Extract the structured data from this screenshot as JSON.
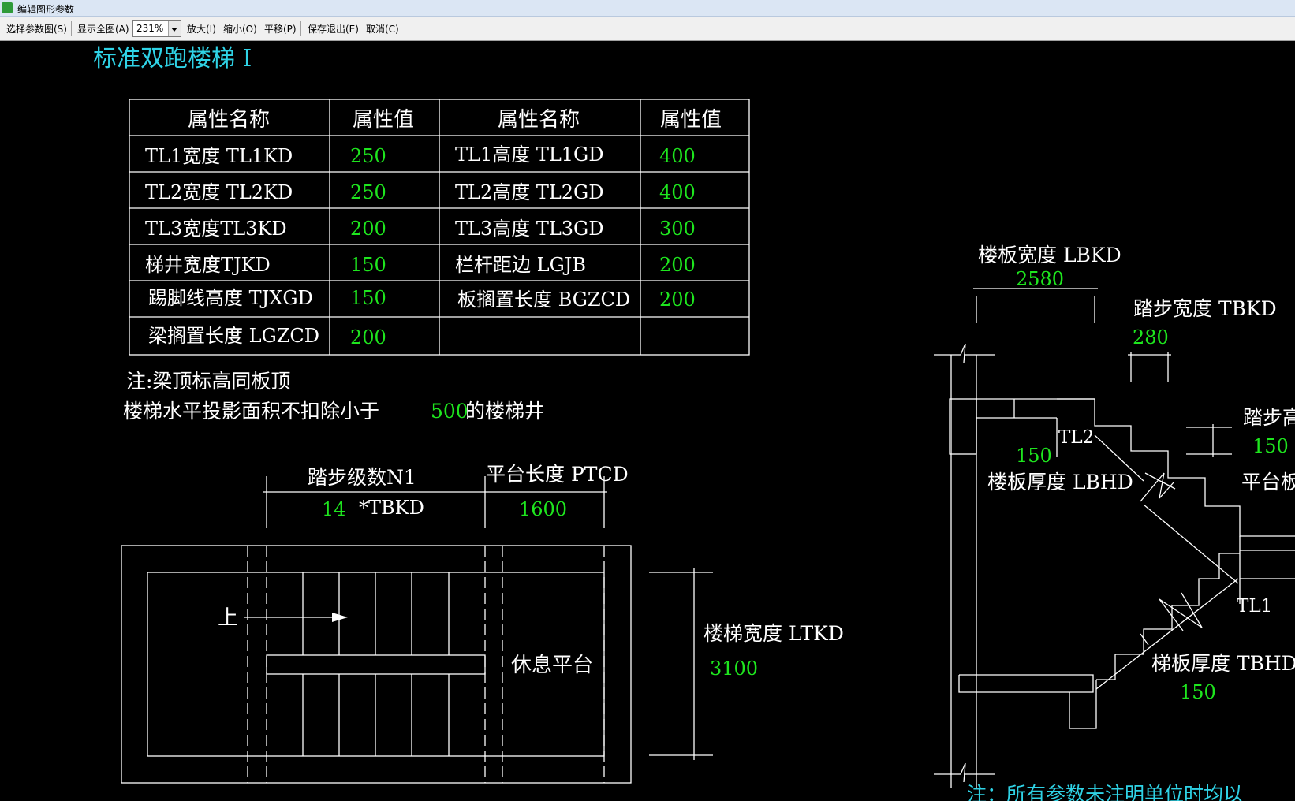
{
  "window": {
    "title": "编辑图形参数"
  },
  "toolbar": {
    "select_params": "选择参数图(S)",
    "show_all": "显示全图(A)",
    "zoom_value": "231%",
    "zoom_in": "放大(I)",
    "zoom_out": "缩小(O)",
    "pan": "平移(P)",
    "save_exit": "保存退出(E)",
    "cancel": "取消(C)"
  },
  "drawing": {
    "title": "标准双跑楼梯 I",
    "table": {
      "headers": [
        "属性名称",
        "属性值",
        "属性名称",
        "属性值"
      ],
      "rows": [
        [
          "TL1宽度 TL1KD",
          "250",
          "TL1高度 TL1GD",
          "400"
        ],
        [
          "TL2宽度 TL2KD",
          "250",
          "TL2高度 TL2GD",
          "400"
        ],
        [
          "TL3宽度TL3KD",
          "200",
          "TL3高度 TL3GD",
          "300"
        ],
        [
          "梯井宽度TJKD",
          "150",
          "栏杆距边 LGJB",
          "200"
        ],
        [
          "踢脚线高度 TJXGD",
          "150",
          "板搁置长度 BGZCD",
          "200"
        ],
        [
          "梁搁置长度 LGZCD",
          "200",
          "",
          ""
        ]
      ]
    },
    "note1": "注:梁顶标高同板顶",
    "note2_prefix": "楼梯水平投影面积不扣除小于",
    "note2_value": "500",
    "note2_suffix": "的楼梯井",
    "plan": {
      "steps_label": "踏步级数N1",
      "steps_value": "14",
      "steps_unit": "*TBKD",
      "platform_len_label": "平台长度 PTCD",
      "platform_len_value": "1600",
      "up_label": "上",
      "rest_platform": "休息平台",
      "stair_width_label": "楼梯宽度 LTKD",
      "stair_width_value": "3100"
    },
    "section": {
      "slab_width_label": "楼板宽度 LBKD",
      "slab_width_value": "2580",
      "tread_width_label": "踏步宽度 TBKD",
      "tread_width_value": "280",
      "tread_height_label": "踏步高",
      "tread_height_value": "150",
      "tl2": "TL2",
      "slab_thick_value": "150",
      "slab_thick_label": "楼板厚度 LBHD",
      "platform_label": "平台板",
      "tl1": "TL1",
      "stair_slab_thick_label": "梯板厚度 TBHD",
      "stair_slab_thick_value": "150",
      "bottom_note": "注：所有参数未注明单位时均以"
    }
  }
}
